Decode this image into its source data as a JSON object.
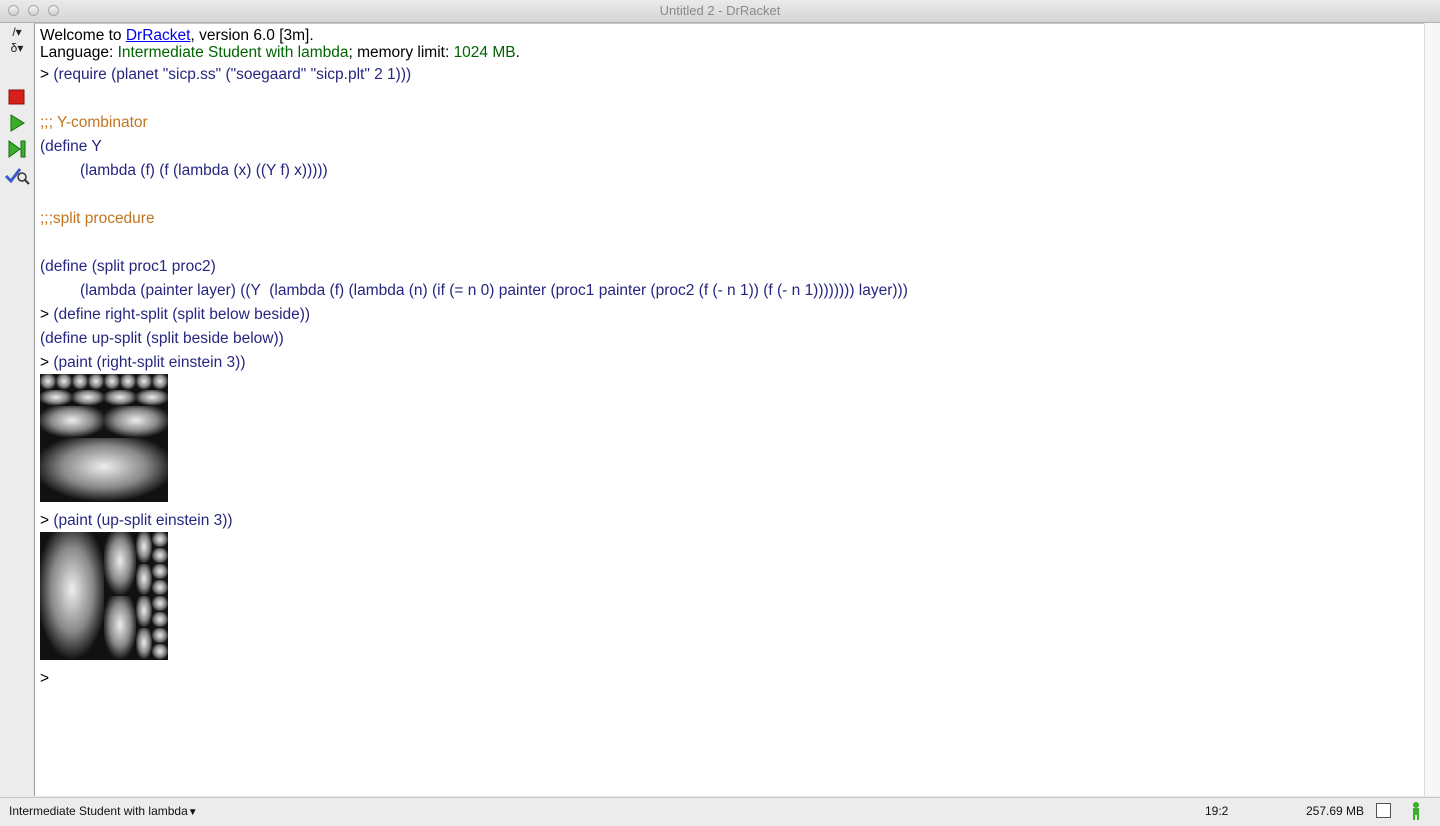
{
  "window": {
    "title": "Untitled 2 - DrRacket"
  },
  "sidebar": {
    "items": [
      {
        "label": "/▾"
      },
      {
        "label": "δ▾"
      }
    ]
  },
  "repl": {
    "welcome_prefix": "Welcome to ",
    "welcome_link": "DrRacket",
    "welcome_suffix": ", version 6.0 [3m].",
    "language_label": "Language: ",
    "language_value": "Intermediate Student with lambda",
    "memory_label": "; memory limit: ",
    "memory_value": "1024 MB",
    "memory_end": ".",
    "prompt": ">",
    "code": {
      "require_line": "(require (planet \"sicp.ss\" (\"soegaard\" \"sicp.plt\" 2 1)))",
      "comment_y": ";;; Y-combinator",
      "define_y": "(define Y",
      "lambda_y": "(lambda (f) (f (lambda (x) ((Y f) x)))))",
      "comment_split": ";;;split procedure",
      "define_split": "(define (split proc1 proc2)",
      "lambda_split": "(lambda (painter layer) ((Y  (lambda (f) (lambda (n) (if (= n 0) painter (proc1 painter (proc2 (f (- n 1)) (f (- n 1)))))))) layer)))",
      "define_right": "(define right-split (split below beside))",
      "define_up": "(define up-split (split beside below))",
      "paint_right": "(paint (right-split einstein 3))",
      "paint_up": "(paint (up-split einstein 3))"
    }
  },
  "status": {
    "language": "Intermediate Student with lambda",
    "position": "19:2",
    "memory": "257.69 MB"
  },
  "colors": {
    "paren": "#8a4b2a",
    "identifier": "#262680",
    "literal": "#2a7a2a",
    "comment": "#c2741f",
    "link": "#0000ee"
  }
}
